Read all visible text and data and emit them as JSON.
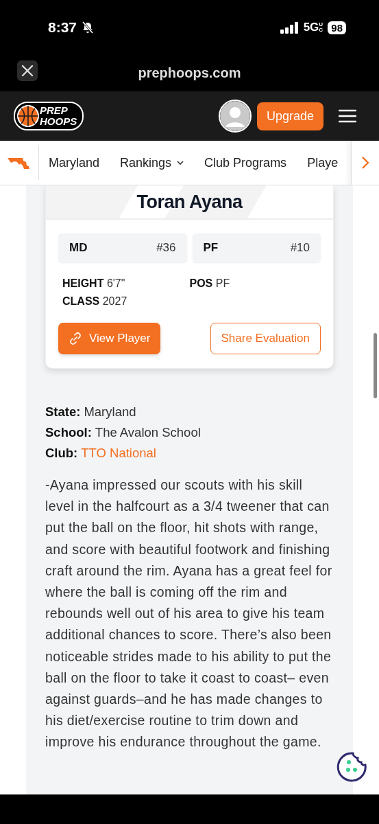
{
  "status_bar": {
    "time": "8:37",
    "silenced": true,
    "network": "5G",
    "network_sub": "UC",
    "battery": "98"
  },
  "browser": {
    "url": "prephoops.com"
  },
  "header": {
    "logo_lines": [
      "PREP",
      "HOOPS"
    ],
    "upgrade_label": "Upgrade"
  },
  "nav": {
    "items": [
      {
        "label": "Maryland",
        "dropdown": false
      },
      {
        "label": "Rankings",
        "dropdown": true
      },
      {
        "label": "Club Programs",
        "dropdown": false
      },
      {
        "label": "Playe",
        "dropdown": false
      }
    ]
  },
  "player_card": {
    "name": "Toran Ayana",
    "ranks": [
      {
        "label": "MD",
        "rank": "#36"
      },
      {
        "label": "PF",
        "rank": "#10"
      }
    ],
    "stats": [
      {
        "label": "HEIGHT",
        "value": "6'7\""
      },
      {
        "label": "POS",
        "value": "PF"
      },
      {
        "label": "CLASS",
        "value": "2027"
      }
    ],
    "buttons": [
      {
        "label": "View Player",
        "kind": "primary"
      },
      {
        "label": "Share Evaluation",
        "kind": "outline"
      }
    ]
  },
  "details": [
    {
      "label": "State:",
      "value": "Maryland",
      "link": false
    },
    {
      "label": "School:",
      "value": "The Avalon School",
      "link": false
    },
    {
      "label": "Club:",
      "value": "TTO National",
      "link": true
    }
  ],
  "evaluation": "-Ayana impressed our scouts with his skill level in the halfcourt as a 3/4 tweener that can put the ball on the floor, hit shots with range, and score with beautiful footwork and finishing craft around the rim. Ayana has a great feel for where the ball is coming off the rim and rebounds well out of his area to give his team additional chances to score. There’s also been noticeable strides made to his ability to put the ball on the floor to take it coast to coast– even against guards–and he has made changes to his diet/exercise routine to trim down and improve his endurance throughout the game."
}
